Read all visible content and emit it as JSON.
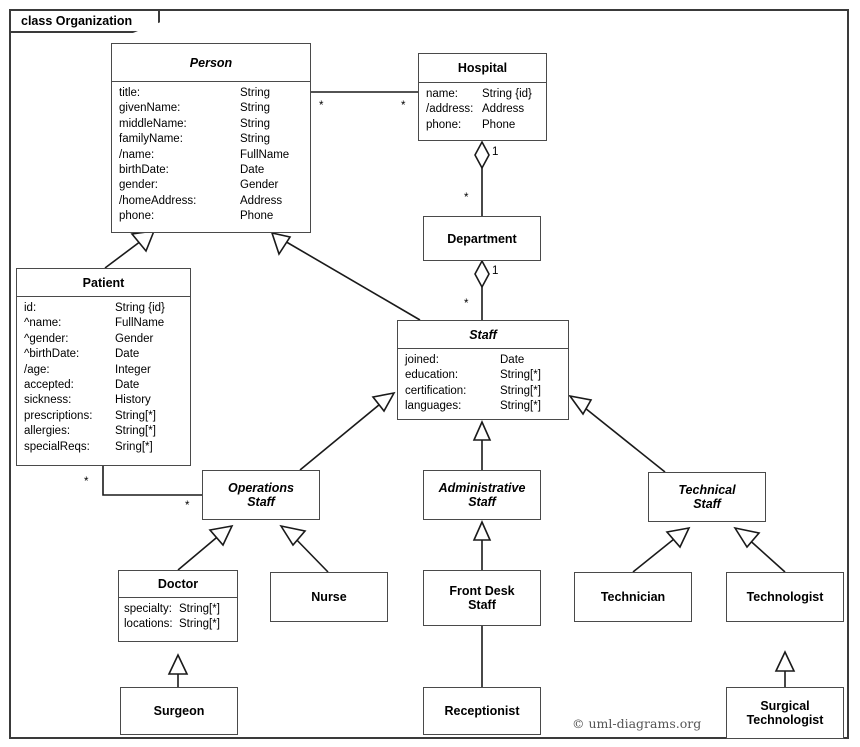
{
  "frame": {
    "label": "class Organization"
  },
  "credit": "© uml-diagrams.org",
  "classes": {
    "person": {
      "name": "Person",
      "attributes": [
        {
          "name": "title:",
          "type": "String"
        },
        {
          "name": "givenName:",
          "type": "String"
        },
        {
          "name": "middleName:",
          "type": "String"
        },
        {
          "name": "familyName:",
          "type": "String"
        },
        {
          "name": "/name:",
          "type": "FullName"
        },
        {
          "name": "birthDate:",
          "type": "Date"
        },
        {
          "name": "gender:",
          "type": "Gender"
        },
        {
          "name": "/homeAddress:",
          "type": "Address"
        },
        {
          "name": "phone:",
          "type": "Phone"
        }
      ]
    },
    "hospital": {
      "name": "Hospital",
      "attributes": [
        {
          "name": "name:",
          "type": "String {id}"
        },
        {
          "name": "/address:",
          "type": "Address"
        },
        {
          "name": "phone:",
          "type": "Phone"
        }
      ]
    },
    "department": {
      "name": "Department",
      "attributes": []
    },
    "patient": {
      "name": "Patient",
      "attributes": [
        {
          "name": "id:",
          "type": "String {id}"
        },
        {
          "name": "^name:",
          "type": "FullName"
        },
        {
          "name": "^gender:",
          "type": "Gender"
        },
        {
          "name": "^birthDate:",
          "type": "Date"
        },
        {
          "name": "/age:",
          "type": "Integer"
        },
        {
          "name": "accepted:",
          "type": "Date"
        },
        {
          "name": "sickness:",
          "type": "History"
        },
        {
          "name": "prescriptions:",
          "type": "String[*]"
        },
        {
          "name": "allergies:",
          "type": "String[*]"
        },
        {
          "name": "specialReqs:",
          "type": "Sring[*]"
        }
      ]
    },
    "staff": {
      "name": "Staff",
      "attributes": [
        {
          "name": "joined:",
          "type": "Date"
        },
        {
          "name": "education:",
          "type": "String[*]"
        },
        {
          "name": "certification:",
          "type": "String[*]"
        },
        {
          "name": "languages:",
          "type": "String[*]"
        }
      ]
    },
    "operations_staff": {
      "name": "Operations\nStaff",
      "attributes": []
    },
    "administrative_staff": {
      "name": "Administrative\nStaff",
      "attributes": []
    },
    "technical_staff": {
      "name": "Technical\nStaff",
      "attributes": []
    },
    "doctor": {
      "name": "Doctor",
      "attributes": [
        {
          "name": "specialty:",
          "type": "String[*]"
        },
        {
          "name": "locations:",
          "type": "String[*]"
        }
      ]
    },
    "nurse": {
      "name": "Nurse",
      "attributes": []
    },
    "front_desk_staff": {
      "name": "Front Desk\nStaff",
      "attributes": []
    },
    "technician": {
      "name": "Technician",
      "attributes": []
    },
    "technologist": {
      "name": "Technologist",
      "attributes": []
    },
    "surgeon": {
      "name": "Surgeon",
      "attributes": []
    },
    "receptionist": {
      "name": "Receptionist",
      "attributes": []
    },
    "surgical_technologist": {
      "name": "Surgical\nTechnologist",
      "attributes": []
    }
  },
  "multiplicities": {
    "person_hospital_person_end": "*",
    "person_hospital_hospital_end": "*",
    "hospital_department_hospital_end": "1",
    "hospital_department_department_end": "*",
    "department_staff_department_end": "1",
    "department_staff_staff_end": "*",
    "patient_operations_patient_end": "*",
    "patient_operations_staff_end": "*"
  },
  "colors": {
    "border": "#4a4a4a",
    "frame_border": "#3a3a3a",
    "line": "#1a1a1a",
    "background": "#ffffff",
    "text": "#000000",
    "credit_text": "#555555"
  }
}
